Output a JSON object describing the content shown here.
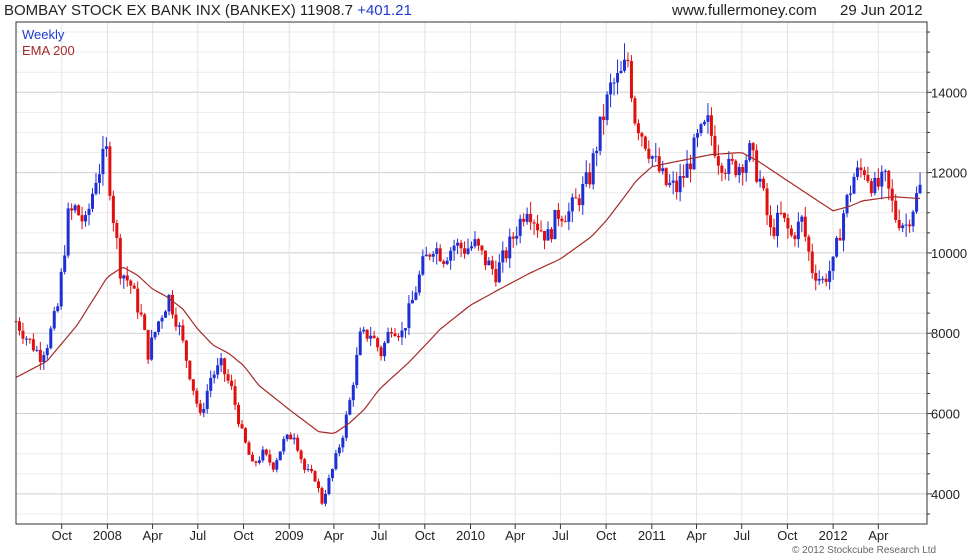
{
  "header": {
    "title": "BOMBAY STOCK EX BANK INX (BANKEX) 11908.7",
    "change": "+401.21",
    "site": "www.fullermoney.com",
    "date": "29 Jun 2012"
  },
  "legend": {
    "period": "Weekly",
    "indicator": "EMA 200"
  },
  "copyright": "© 2012 Stockcube Research Ltd",
  "colors": {
    "up": "#1f2fd6",
    "down": "#e01010",
    "ema": "#a52a2a",
    "grid": "#d9d9d9",
    "axis": "#333333"
  },
  "chart_data": {
    "type": "candlestick",
    "grid": true,
    "y_range": [
      3250,
      15750
    ],
    "y_ticks": [
      4000,
      6000,
      8000,
      10000,
      12000,
      14000
    ],
    "y_tick_labels": [
      "4000",
      "6000",
      "8000",
      "10000",
      "12000",
      "14000"
    ],
    "x_ticks": [
      {
        "label": "Oct",
        "date": "2007-10-01"
      },
      {
        "label": "2008",
        "date": "2008-01-01"
      },
      {
        "label": "Apr",
        "date": "2008-04-01"
      },
      {
        "label": "Jul",
        "date": "2008-07-01"
      },
      {
        "label": "Oct",
        "date": "2008-10-01"
      },
      {
        "label": "2009",
        "date": "2009-01-01"
      },
      {
        "label": "Apr",
        "date": "2009-04-01"
      },
      {
        "label": "Jul",
        "date": "2009-07-01"
      },
      {
        "label": "Oct",
        "date": "2009-10-01"
      },
      {
        "label": "2010",
        "date": "2010-01-01"
      },
      {
        "label": "Apr",
        "date": "2010-04-01"
      },
      {
        "label": "Jul",
        "date": "2010-07-01"
      },
      {
        "label": "Oct",
        "date": "2010-10-01"
      },
      {
        "label": "2011",
        "date": "2011-01-01"
      },
      {
        "label": "Apr",
        "date": "2011-04-01"
      },
      {
        "label": "Jul",
        "date": "2011-07-01"
      },
      {
        "label": "Oct",
        "date": "2011-10-01"
      },
      {
        "label": "2012",
        "date": "2012-01-01"
      },
      {
        "label": "Apr",
        "date": "2012-04-01"
      }
    ],
    "close_path": [
      [
        "2007-07-01",
        8300
      ],
      [
        "2007-07-22",
        7900
      ],
      [
        "2007-08-19",
        7450
      ],
      [
        "2007-09-02",
        7750
      ],
      [
        "2007-09-23",
        8650
      ],
      [
        "2007-10-14",
        10900
      ],
      [
        "2007-10-28",
        11100
      ],
      [
        "2007-11-18",
        10700
      ],
      [
        "2007-12-09",
        11900
      ],
      [
        "2007-12-30",
        12500
      ],
      [
        "2008-01-13",
        10900
      ],
      [
        "2008-01-27",
        9600
      ],
      [
        "2008-02-17",
        9200
      ],
      [
        "2008-03-09",
        8400
      ],
      [
        "2008-03-23",
        7500
      ],
      [
        "2008-04-13",
        8300
      ],
      [
        "2008-05-04",
        8900
      ],
      [
        "2008-05-25",
        8100
      ],
      [
        "2008-06-15",
        7000
      ],
      [
        "2008-07-06",
        5900
      ],
      [
        "2008-07-27",
        6900
      ],
      [
        "2008-08-17",
        7200
      ],
      [
        "2008-09-07",
        6600
      ],
      [
        "2008-09-28",
        5500
      ],
      [
        "2008-10-19",
        4700
      ],
      [
        "2008-11-09",
        5000
      ],
      [
        "2008-11-30",
        4700
      ],
      [
        "2008-12-21",
        5300
      ],
      [
        "2009-01-11",
        5500
      ],
      [
        "2009-02-01",
        4600
      ],
      [
        "2009-02-22",
        4400
      ],
      [
        "2009-03-08",
        3800
      ],
      [
        "2009-03-29",
        4600
      ],
      [
        "2009-04-19",
        5500
      ],
      [
        "2009-05-03",
        6300
      ],
      [
        "2009-05-24",
        7900
      ],
      [
        "2009-06-14",
        8000
      ],
      [
        "2009-07-05",
        7500
      ],
      [
        "2009-07-26",
        8200
      ],
      [
        "2009-08-16",
        8000
      ],
      [
        "2009-09-06",
        8800
      ],
      [
        "2009-09-27",
        9700
      ],
      [
        "2009-10-18",
        10200
      ],
      [
        "2009-11-08",
        9900
      ],
      [
        "2009-11-29",
        10200
      ],
      [
        "2009-12-20",
        10100
      ],
      [
        "2010-01-10",
        10200
      ],
      [
        "2010-01-31",
        9800
      ],
      [
        "2010-02-21",
        9500
      ],
      [
        "2010-03-14",
        10000
      ],
      [
        "2010-04-04",
        10600
      ],
      [
        "2010-04-25",
        11200
      ],
      [
        "2010-05-16",
        10700
      ],
      [
        "2010-06-06",
        10400
      ],
      [
        "2010-06-27",
        11000
      ],
      [
        "2010-07-18",
        11000
      ],
      [
        "2010-08-08",
        11400
      ],
      [
        "2010-08-29",
        11900
      ],
      [
        "2010-09-19",
        13100
      ],
      [
        "2010-10-10",
        14100
      ],
      [
        "2010-10-31",
        14400
      ],
      [
        "2010-11-14",
        14800
      ],
      [
        "2010-11-28",
        13400
      ],
      [
        "2010-12-19",
        12800
      ],
      [
        "2011-01-09",
        12200
      ],
      [
        "2011-01-30",
        11700
      ],
      [
        "2011-02-20",
        11600
      ],
      [
        "2011-03-13",
        12100
      ],
      [
        "2011-04-03",
        12800
      ],
      [
        "2011-04-24",
        13200
      ],
      [
        "2011-05-15",
        12400
      ],
      [
        "2011-06-05",
        12100
      ],
      [
        "2011-06-26",
        12200
      ],
      [
        "2011-07-17",
        12500
      ],
      [
        "2011-08-07",
        11800
      ],
      [
        "2011-08-28",
        10500
      ],
      [
        "2011-09-18",
        10900
      ],
      [
        "2011-10-09",
        10400
      ],
      [
        "2011-10-30",
        10800
      ],
      [
        "2011-11-20",
        9600
      ],
      [
        "2011-12-11",
        9300
      ],
      [
        "2012-01-01",
        9700
      ],
      [
        "2012-01-22",
        11000
      ],
      [
        "2012-02-12",
        11900
      ],
      [
        "2012-03-04",
        12100
      ],
      [
        "2012-03-25",
        11600
      ],
      [
        "2012-04-15",
        11800
      ],
      [
        "2012-05-06",
        10900
      ],
      [
        "2012-05-27",
        10700
      ],
      [
        "2012-06-17",
        11400
      ],
      [
        "2012-06-29",
        11908.7
      ]
    ],
    "ema_path": [
      [
        "2007-07-01",
        6900
      ],
      [
        "2007-09-01",
        7300
      ],
      [
        "2007-11-01",
        8200
      ],
      [
        "2008-01-01",
        9400
      ],
      [
        "2008-02-01",
        9650
      ],
      [
        "2008-03-01",
        9450
      ],
      [
        "2008-04-01",
        9100
      ],
      [
        "2008-05-01",
        8900
      ],
      [
        "2008-06-01",
        8600
      ],
      [
        "2008-07-01",
        8100
      ],
      [
        "2008-08-01",
        7700
      ],
      [
        "2008-09-01",
        7500
      ],
      [
        "2008-10-01",
        7200
      ],
      [
        "2008-11-01",
        6700
      ],
      [
        "2009-01-01",
        6100
      ],
      [
        "2009-03-01",
        5550
      ],
      [
        "2009-04-01",
        5500
      ],
      [
        "2009-05-01",
        5750
      ],
      [
        "2009-06-01",
        6100
      ],
      [
        "2009-07-01",
        6600
      ],
      [
        "2009-09-01",
        7300
      ],
      [
        "2009-11-01",
        8100
      ],
      [
        "2010-01-01",
        8700
      ],
      [
        "2010-03-01",
        9100
      ],
      [
        "2010-05-01",
        9500
      ],
      [
        "2010-07-01",
        9850
      ],
      [
        "2010-09-01",
        10400
      ],
      [
        "2010-10-01",
        10800
      ],
      [
        "2010-11-01",
        11300
      ],
      [
        "2010-12-01",
        11800
      ],
      [
        "2011-01-01",
        12150
      ],
      [
        "2011-03-01",
        12300
      ],
      [
        "2011-05-01",
        12450
      ],
      [
        "2011-07-01",
        12500
      ],
      [
        "2011-08-01",
        12300
      ],
      [
        "2011-10-01",
        11800
      ],
      [
        "2011-12-01",
        11300
      ],
      [
        "2012-01-01",
        11050
      ],
      [
        "2012-02-01",
        11150
      ],
      [
        "2012-03-01",
        11300
      ],
      [
        "2012-05-01",
        11400
      ],
      [
        "2012-06-29",
        11350
      ]
    ]
  }
}
